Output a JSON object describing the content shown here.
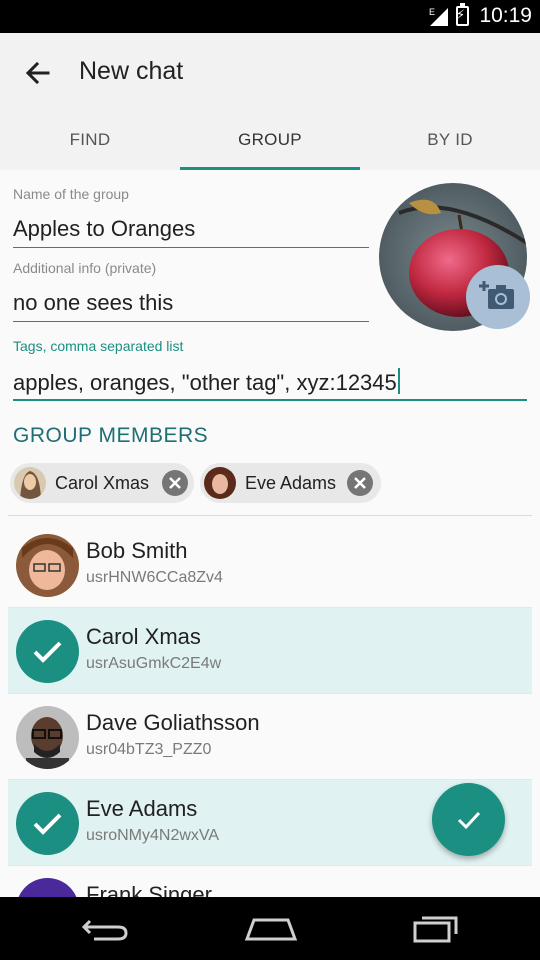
{
  "status": {
    "time": "10:19",
    "network": "E"
  },
  "header": {
    "title": "New chat"
  },
  "tabs": [
    {
      "label": "FIND"
    },
    {
      "label": "GROUP",
      "active": true
    },
    {
      "label": "BY ID"
    }
  ],
  "form": {
    "group_name_label": "Name of the group",
    "group_name_value": "Apples to Oranges",
    "info_label": "Additional info (private)",
    "info_value": "no one sees this",
    "tags_label": "Tags, comma separated list",
    "tags_value": "apples, oranges, \"other tag\", xyz:12345"
  },
  "section_title": "GROUP MEMBERS",
  "chips": [
    {
      "name": "Carol Xmas"
    },
    {
      "name": "Eve Adams"
    }
  ],
  "contacts": [
    {
      "name": "Bob Smith",
      "id": "usrHNW6CCa8Zv4",
      "selected": false
    },
    {
      "name": "Carol Xmas",
      "id": "usrAsuGmkC2E4w",
      "selected": true
    },
    {
      "name": "Dave Goliathsson",
      "id": "usr04bTZ3_PZZ0",
      "selected": false
    },
    {
      "name": "Eve Adams",
      "id": "usroNMy4N2wxVA",
      "selected": true
    },
    {
      "name": "Frank Singer",
      "id": "",
      "selected": false
    }
  ],
  "colors": {
    "accent": "#1a8f82",
    "selected_row": "#e0f2f1",
    "section": "#1e6f73"
  }
}
